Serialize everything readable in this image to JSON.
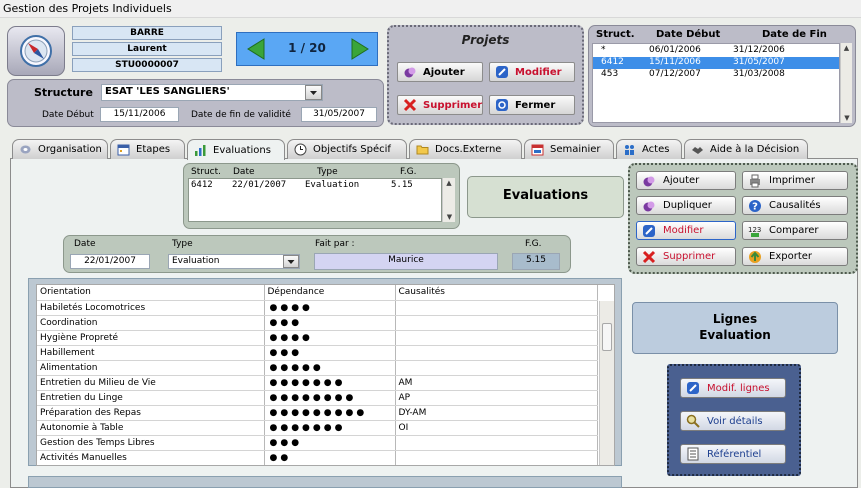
{
  "window_title": "Gestion des Projets Individuels",
  "person": {
    "last_name": "BARRE",
    "first_name": "Laurent",
    "id": "STU0000007"
  },
  "nav": {
    "position": "1 / 20"
  },
  "structure": {
    "label": "Structure",
    "value": "ESAT 'LES SANGLIERS'",
    "date_debut_label": "Date Début",
    "date_debut": "15/11/2006",
    "date_fin_label": "Date de fin de validité",
    "date_fin": "31/05/2007"
  },
  "projets": {
    "title": "Projets",
    "ajouter": "Ajouter",
    "modifier": "Modifier",
    "supprimer": "Supprimer",
    "fermer": "Fermer"
  },
  "struct_list": {
    "headers": [
      "Struct.",
      "Date Début",
      "Date de Fin"
    ],
    "rows": [
      {
        "struct": "*",
        "debut": "06/01/2006",
        "fin": "31/12/2006"
      },
      {
        "struct": "6412",
        "debut": "15/11/2006",
        "fin": "31/05/2007"
      },
      {
        "struct": "453",
        "debut": "07/12/2007",
        "fin": "31/03/2008"
      }
    ]
  },
  "tabs": [
    "Organisation",
    "Etapes",
    "Evaluations",
    "Objectifs Spécif",
    "Docs.Externe",
    "Semainier",
    "Actes",
    "Aide à la Décision"
  ],
  "eval_list": {
    "headers": [
      "Struct.",
      "Date",
      "Type",
      "F.G."
    ],
    "rows": [
      {
        "struct": "6412",
        "date": "22/01/2007",
        "type": "Evaluation",
        "fg": "5.15"
      }
    ]
  },
  "evaluations_title": "Evaluations",
  "actions": {
    "ajouter": "Ajouter",
    "imprimer": "Imprimer",
    "dupliquer": "Dupliquer",
    "causalites": "Causalités",
    "modifier": "Modifier",
    "comparer": "Comparer",
    "supprimer": "Supprimer",
    "exporter": "Exporter"
  },
  "eval_detail": {
    "date_label": "Date",
    "date": "22/01/2007",
    "type_label": "Type",
    "type": "Evaluation",
    "fait_par_label": "Fait par :",
    "fait_par": "Maurice",
    "fg_label": "F.G.",
    "fg": "5.15"
  },
  "grid": {
    "headers": [
      "Orientation",
      "Dépendance",
      "Causalités"
    ],
    "rows": [
      {
        "orientation": "Habiletés Locomotrices",
        "dependance": 4,
        "causalites": ""
      },
      {
        "orientation": "Coordination",
        "dependance": 3,
        "causalites": ""
      },
      {
        "orientation": "Hygiène Propreté",
        "dependance": 4,
        "causalites": ""
      },
      {
        "orientation": "Habillement",
        "dependance": 3,
        "causalites": ""
      },
      {
        "orientation": "Alimentation",
        "dependance": 5,
        "causalites": ""
      },
      {
        "orientation": "Entretien du Milieu de Vie",
        "dependance": 7,
        "causalites": "AM"
      },
      {
        "orientation": "Entretien du Linge",
        "dependance": 8,
        "causalites": "AP"
      },
      {
        "orientation": "Préparation des Repas",
        "dependance": 9,
        "causalites": "DY-AM"
      },
      {
        "orientation": "Autonomie à Table",
        "dependance": 7,
        "causalites": "OI"
      },
      {
        "orientation": "Gestion des Temps Libres",
        "dependance": 3,
        "causalites": ""
      },
      {
        "orientation": "Activités Manuelles",
        "dependance": 2,
        "causalites": ""
      }
    ]
  },
  "lignes": {
    "title_line1": "Lignes",
    "title_line2": "Evaluation",
    "modif": "Modif. lignes",
    "voir": "Voir détails",
    "referentiel": "Référentiel"
  },
  "colors": {
    "panel": "#bcbcc8",
    "selection": "#3d8ee8",
    "accent_red": "#c8102e",
    "nav_bg": "#5aa7f4"
  }
}
